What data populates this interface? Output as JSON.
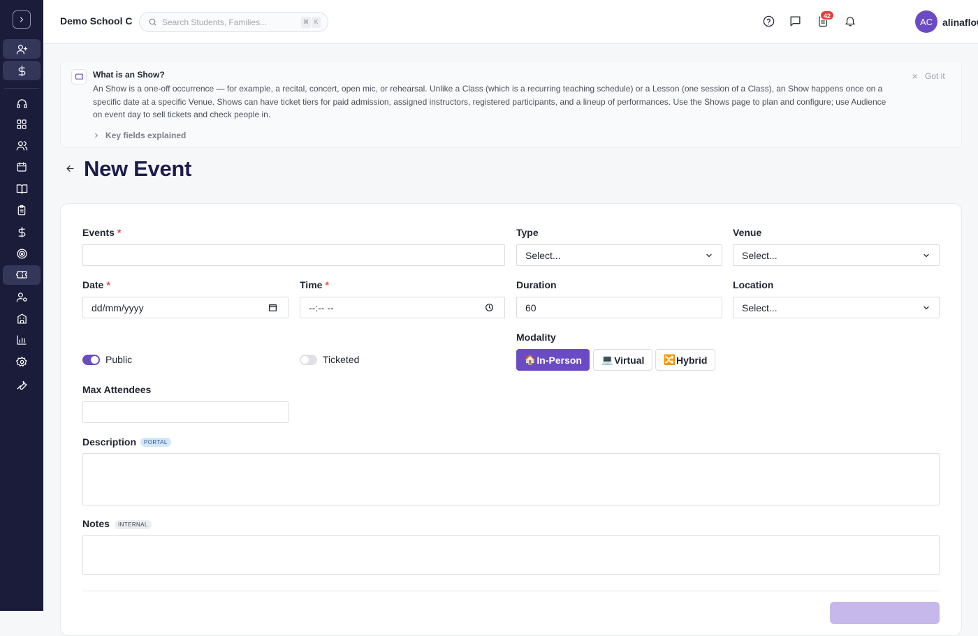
{
  "topbar": {
    "school_name": "Demo School C",
    "search_placeholder": "Search Students, Families...",
    "shortcut_key1": "⌘",
    "shortcut_key2": "K",
    "notification_count": "42",
    "avatar_initials": "AC",
    "username": "alinaflow"
  },
  "info_banner": {
    "title": "What is an Show?",
    "body": "An Show is a one-off occurrence — for example, a recital, concert, open mic, or rehearsal. Unlike a Class (which is a recurring teaching schedule) or a Lesson (one session of a Class), an Show happens once on a specific date at a specific Venue. Shows can have ticket tiers for paid admission, assigned instructors, registered participants, and a lineup of performances. Use the Shows page to plan and configure; use Audience on event day to sell tickets and check people in.",
    "more_label": "Key fields explained",
    "dismiss_label": "Got it"
  },
  "page": {
    "title": "New Event"
  },
  "form": {
    "events_label": "Events",
    "type_label": "Type",
    "type_value": "Select...",
    "venue_label": "Venue",
    "venue_value": "Select...",
    "date_label": "Date",
    "date_placeholder": "dd/mm/yyyy",
    "time_label": "Time",
    "time_placeholder": "--:-- --",
    "duration_label": "Duration",
    "duration_value": "60",
    "location_label": "Location",
    "location_value": "Select...",
    "modality_label": "Modality",
    "modality_options": [
      {
        "icon": "🏠",
        "label": "In-Person",
        "active": true
      },
      {
        "icon": "💻",
        "label": "Virtual",
        "active": false
      },
      {
        "icon": "🔀",
        "label": "Hybrid",
        "active": false
      }
    ],
    "public_label": "Public",
    "public_on": true,
    "ticketed_label": "Ticketed",
    "ticketed_on": false,
    "max_attendees_label": "Max Attendees",
    "description_label": "Description",
    "description_tag": "PORTAL",
    "notes_label": "Notes",
    "notes_tag": "INTERNAL",
    "required_mark": "*"
  },
  "colors": {
    "sidebar_bg": "#1b1c3a",
    "accent": "#6b4bc4",
    "badge": "#e1433c",
    "title": "#1b1c4a"
  },
  "sidebar": {
    "icons": [
      "chevron-right-icon",
      "user-plus-icon",
      "dollar-icon",
      "headset-icon",
      "dashboard-icon",
      "users-icon",
      "calendar-icon",
      "book-icon",
      "clipboard-icon",
      "dollar-icon",
      "target-icon",
      "ticket-icon",
      "user-cog-icon",
      "building-icon",
      "bar-chart-icon",
      "gear-icon",
      "wrench-icon"
    ]
  }
}
